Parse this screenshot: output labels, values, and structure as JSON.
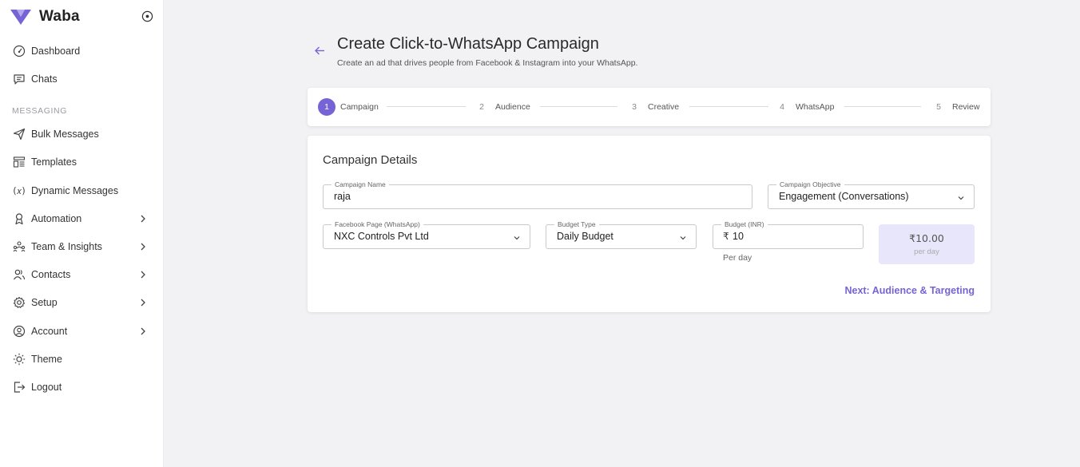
{
  "brand": {
    "name": "Waba",
    "accent": "#7664d6"
  },
  "sidebar": {
    "section_messaging": "MESSAGING",
    "items": [
      {
        "label": "Dashboard",
        "icon": "gauge-icon"
      },
      {
        "label": "Chats",
        "icon": "chat-icon"
      },
      {
        "label": "Bulk Messages",
        "icon": "send-icon"
      },
      {
        "label": "Templates",
        "icon": "template-icon"
      },
      {
        "label": "Dynamic Messages",
        "icon": "variable-icon"
      },
      {
        "label": "Automation",
        "icon": "robot-icon"
      },
      {
        "label": "Team & Insights",
        "icon": "team-icon"
      },
      {
        "label": "Contacts",
        "icon": "contacts-icon"
      },
      {
        "label": "Setup",
        "icon": "gear-icon"
      },
      {
        "label": "Account",
        "icon": "user-circle-icon"
      },
      {
        "label": "Theme",
        "icon": "sun-icon"
      },
      {
        "label": "Logout",
        "icon": "logout-icon"
      }
    ]
  },
  "page": {
    "title": "Create Click-to-WhatsApp Campaign",
    "subtitle": "Create an ad that drives people from Facebook & Instagram into your WhatsApp."
  },
  "stepper": {
    "steps": [
      {
        "num": "1",
        "label": "Campaign",
        "active": true
      },
      {
        "num": "2",
        "label": "Audience",
        "active": false
      },
      {
        "num": "3",
        "label": "Creative",
        "active": false
      },
      {
        "num": "4",
        "label": "WhatsApp",
        "active": false
      },
      {
        "num": "5",
        "label": "Review",
        "active": false
      }
    ]
  },
  "form": {
    "section_title": "Campaign Details",
    "campaign_name": {
      "label": "Campaign Name",
      "value": "raja"
    },
    "objective": {
      "label": "Campaign Objective",
      "value": "Engagement (Conversations)"
    },
    "facebook_page": {
      "label": "Facebook Page (WhatsApp)",
      "value": "NXC Controls Pvt Ltd"
    },
    "budget_type": {
      "label": "Budget Type",
      "value": "Daily Budget"
    },
    "budget": {
      "label": "Budget (INR)",
      "currency": "₹",
      "value": "10",
      "helper": "Per day"
    },
    "summary": {
      "amount": "₹10.00",
      "sub": "per day"
    },
    "next_label": "Next: Audience & Targeting"
  }
}
